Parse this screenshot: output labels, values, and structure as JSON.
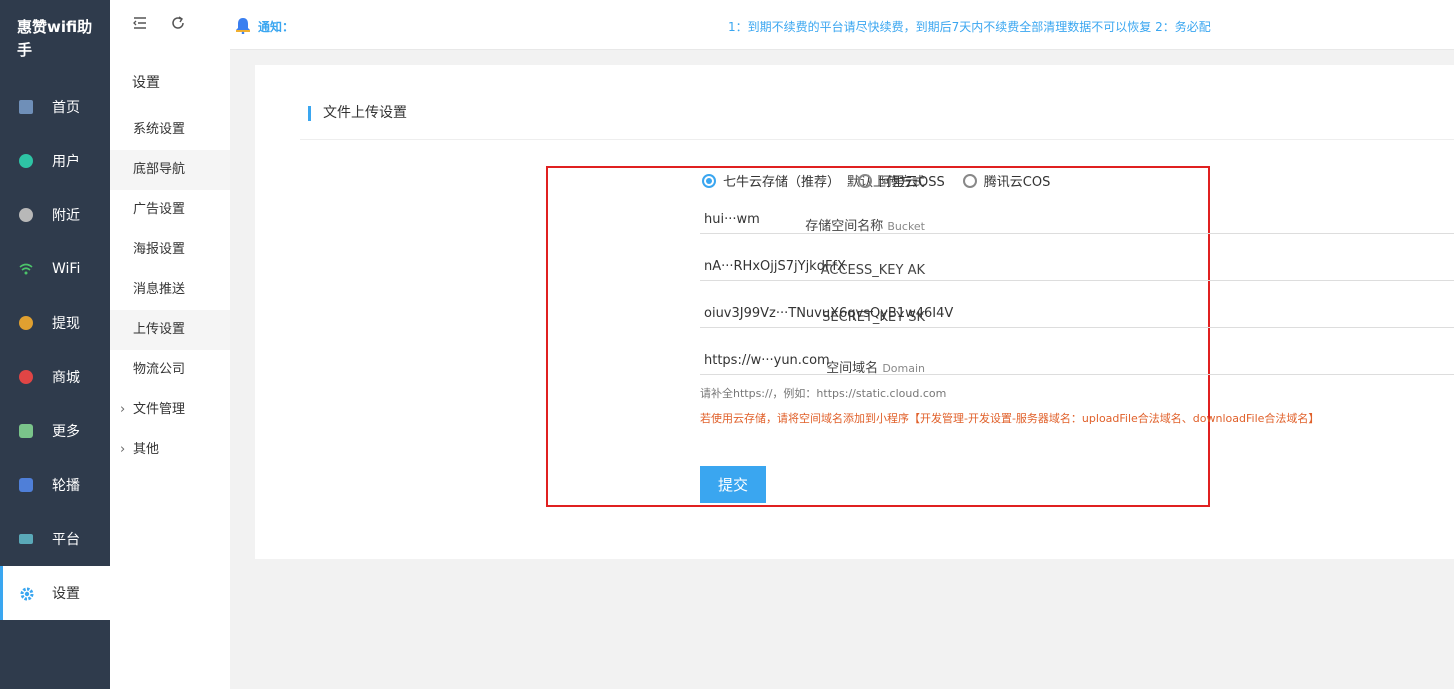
{
  "app": {
    "brand": "惠赞wifi助手"
  },
  "nav": {
    "items": [
      {
        "label": "首页",
        "icon": "home-icon",
        "color": "#6f8fb8"
      },
      {
        "label": "用户",
        "icon": "user-icon",
        "color": "#2ec4a5"
      },
      {
        "label": "附近",
        "icon": "location-icon",
        "color": "#b8b8b8"
      },
      {
        "label": "WiFi",
        "icon": "wifi-icon",
        "color": "#4cc46a"
      },
      {
        "label": "提现",
        "icon": "coin-icon",
        "color": "#e0a030"
      },
      {
        "label": "商城",
        "icon": "shop-icon",
        "color": "#e04545"
      },
      {
        "label": "更多",
        "icon": "grid-icon",
        "color": "#7ac48a"
      },
      {
        "label": "轮播",
        "icon": "carousel-icon",
        "color": "#4f7fd8"
      },
      {
        "label": "平台",
        "icon": "monitor-icon",
        "color": "#5aa9b8"
      },
      {
        "label": "设置",
        "icon": "gear-icon",
        "color": "#3aa6f0",
        "active": true
      }
    ]
  },
  "subnav": {
    "title": "设置",
    "items": [
      {
        "label": "系统设置"
      },
      {
        "label": "底部导航"
      },
      {
        "label": "广告设置"
      },
      {
        "label": "海报设置"
      },
      {
        "label": "消息推送"
      },
      {
        "label": "上传设置"
      },
      {
        "label": "物流公司"
      },
      {
        "label": "文件管理",
        "expandable": true
      },
      {
        "label": "其他",
        "expandable": true
      }
    ]
  },
  "topbar": {
    "notice_label": "通知：",
    "notice_text": "1：到期不续费的平台请尽快续费，到期后7天内不续费全部清理数据不可以恢复 2：务必配"
  },
  "section": {
    "title": "文件上传设置"
  },
  "form": {
    "method_label": "默认上传方式",
    "methods": [
      "七牛云存储（推荐）",
      "阿里云OSS",
      "腾讯云COS"
    ],
    "selected_method": "七牛云存储（推荐）",
    "bucket_label": "存储空间名称",
    "bucket_sub": "Bucket",
    "bucket_value": "hui···wm",
    "ak_label": "ACCESS_KEY AK",
    "ak_value": "nA···RHxOjjS7jYjkdFfX",
    "sk_label": "SECRET_KEY SK",
    "sk_value": "oiuv3J99Vz···TNuvuX6qvsQyB1w46I4V",
    "domain_label": "空间域名",
    "domain_sub": "Domain",
    "domain_value": "https://w···yun.com",
    "hint": "请补全https://，例如：https://static.cloud.com",
    "warning": "若使用云存储，请将空间域名添加到小程序【开发管理-开发设置-服务器域名：uploadFile合法域名、downloadFile合法域名】",
    "submit_label": "提交"
  }
}
